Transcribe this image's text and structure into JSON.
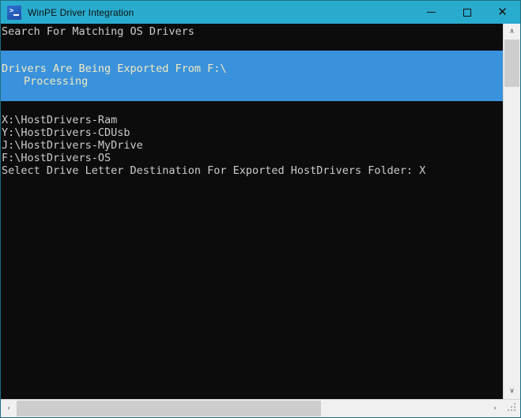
{
  "window": {
    "title": "WinPE Driver Integration",
    "icon": "powershell-icon",
    "titlebar_color": "#29abce",
    "controls": {
      "minimize": "minimize-button",
      "maximize": "maximize-button",
      "close": "close-button"
    }
  },
  "console": {
    "background_color": "#0c0c0c",
    "text_color": "#cccccc",
    "header_line": "Search For Matching OS Drivers",
    "progress": {
      "background_color": "#3a92dc",
      "text_color": "#f3eac0",
      "activity": "Drivers Are Being Exported From F:\\",
      "status": "Processing"
    },
    "output_lines": [
      "X:\\HostDrivers-Ram",
      "Y:\\HostDrivers-CDUsb",
      "J:\\HostDrivers-MyDrive",
      "F:\\HostDrivers-OS",
      "Select Drive Letter Destination For Exported HostDrivers Folder: X"
    ]
  },
  "scrollbars": {
    "vertical": {
      "up_arrow": "∧",
      "down_arrow": "∨"
    },
    "horizontal": {
      "left_arrow": "‹",
      "right_arrow": "›"
    }
  }
}
